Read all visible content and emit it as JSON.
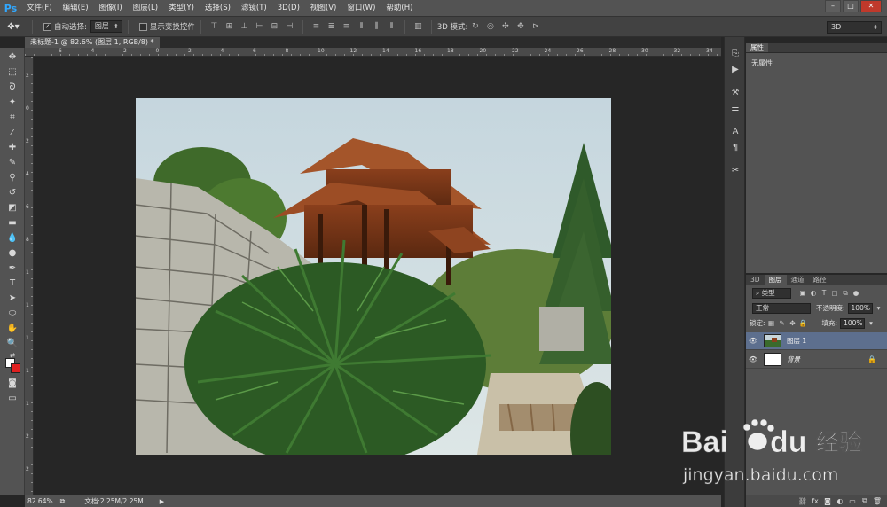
{
  "app": {
    "logo": "Ps"
  },
  "menu": [
    "文件(F)",
    "编辑(E)",
    "图像(I)",
    "图层(L)",
    "类型(Y)",
    "选择(S)",
    "滤镜(T)",
    "3D(D)",
    "视图(V)",
    "窗口(W)",
    "帮助(H)"
  ],
  "window_controls": [
    "–",
    "□",
    "✕"
  ],
  "options": {
    "auto_select_label": "自动选择:",
    "auto_select_value": "图层",
    "show_transform_label": "显示变换控件",
    "mode_3d_label": "3D 模式:",
    "workspace_value": "3D"
  },
  "document": {
    "tab_title": "未标题-1 @ 82.6% (图层 1, RGB/8) *"
  },
  "ruler": {
    "top_ticks": [
      "6",
      "4",
      "2",
      "0",
      "2",
      "4",
      "6",
      "8",
      "10",
      "12",
      "14",
      "16",
      "18",
      "20",
      "22",
      "24",
      "26",
      "28",
      "30",
      "32",
      "34"
    ],
    "left_ticks": [
      "2",
      "0",
      "2",
      "4",
      "6",
      "8",
      "1",
      "1",
      "1",
      "1",
      "1",
      "2",
      "2"
    ]
  },
  "status": {
    "zoom": "82.64%",
    "doc_info": "文档:2.25M/2.25M"
  },
  "properties": {
    "tab": "属性",
    "body": "无属性"
  },
  "layers_panel": {
    "tabs": [
      "3D",
      "图层",
      "通道",
      "路径"
    ],
    "filter_label": "类型",
    "blend_mode": "正常",
    "opacity_label": "不透明度:",
    "opacity_value": "100%",
    "lock_label": "锁定:",
    "fill_label": "填充:",
    "fill_value": "100%",
    "layers": [
      {
        "name": "图层 1"
      },
      {
        "name": "背景"
      }
    ]
  },
  "watermark": {
    "brand": "Bai",
    "brand2": "du",
    "cn": "经验",
    "url": "jingyan.baidu.com"
  },
  "colors": {
    "foreground": "#ffffff",
    "background": "#e02020",
    "accent": "#31a8ff",
    "selected_layer": "#5d6f8e"
  }
}
